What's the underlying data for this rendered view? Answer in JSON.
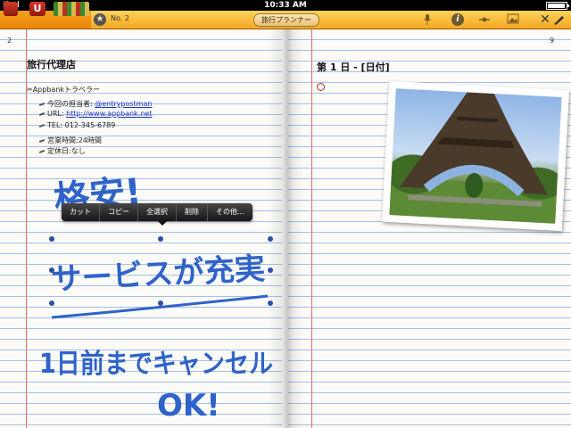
{
  "status_bar": {
    "device": "iPad",
    "time": "10:33 AM"
  },
  "toolbar": {
    "back_label": "U",
    "notebook_number": "No. 2",
    "title": "旅行プランナー",
    "icons": [
      "app-icon",
      "back-icon",
      "pencils-icon",
      "star-icon",
      "mic-icon",
      "info-icon",
      "shape-icon",
      "image-icon",
      "close-icon"
    ]
  },
  "left_page": {
    "page_number": "2",
    "heading": "旅行代理店",
    "company": "Appbankトラベラー",
    "lines": [
      {
        "label": "今回の担当者:",
        "value": "@entrypostman"
      },
      {
        "label": "URL:",
        "value": "http://www.appbank.net"
      },
      {
        "label": "TEL:",
        "value": "012-345-6789"
      },
      {
        "label": "営業時間:",
        "value": "24時間"
      },
      {
        "label": "定休日:",
        "value": "なし"
      }
    ],
    "handwriting": [
      "格安!",
      "サービスが充実",
      "1日前までキャンセル",
      "OK!"
    ]
  },
  "context_menu": {
    "items": [
      "カット",
      "コピー",
      "全選択",
      "削除",
      "その他..."
    ]
  },
  "right_page": {
    "page_number": "9",
    "heading": "第 1 日 - [日付]",
    "photo_subject": "eiffel-tower-photo"
  },
  "colors": {
    "toolbar": "#f0941a",
    "ruling": "#a9bfe5",
    "margin": "#e46a6a",
    "ink": "#2f63c9",
    "link": "#1a35c9"
  }
}
